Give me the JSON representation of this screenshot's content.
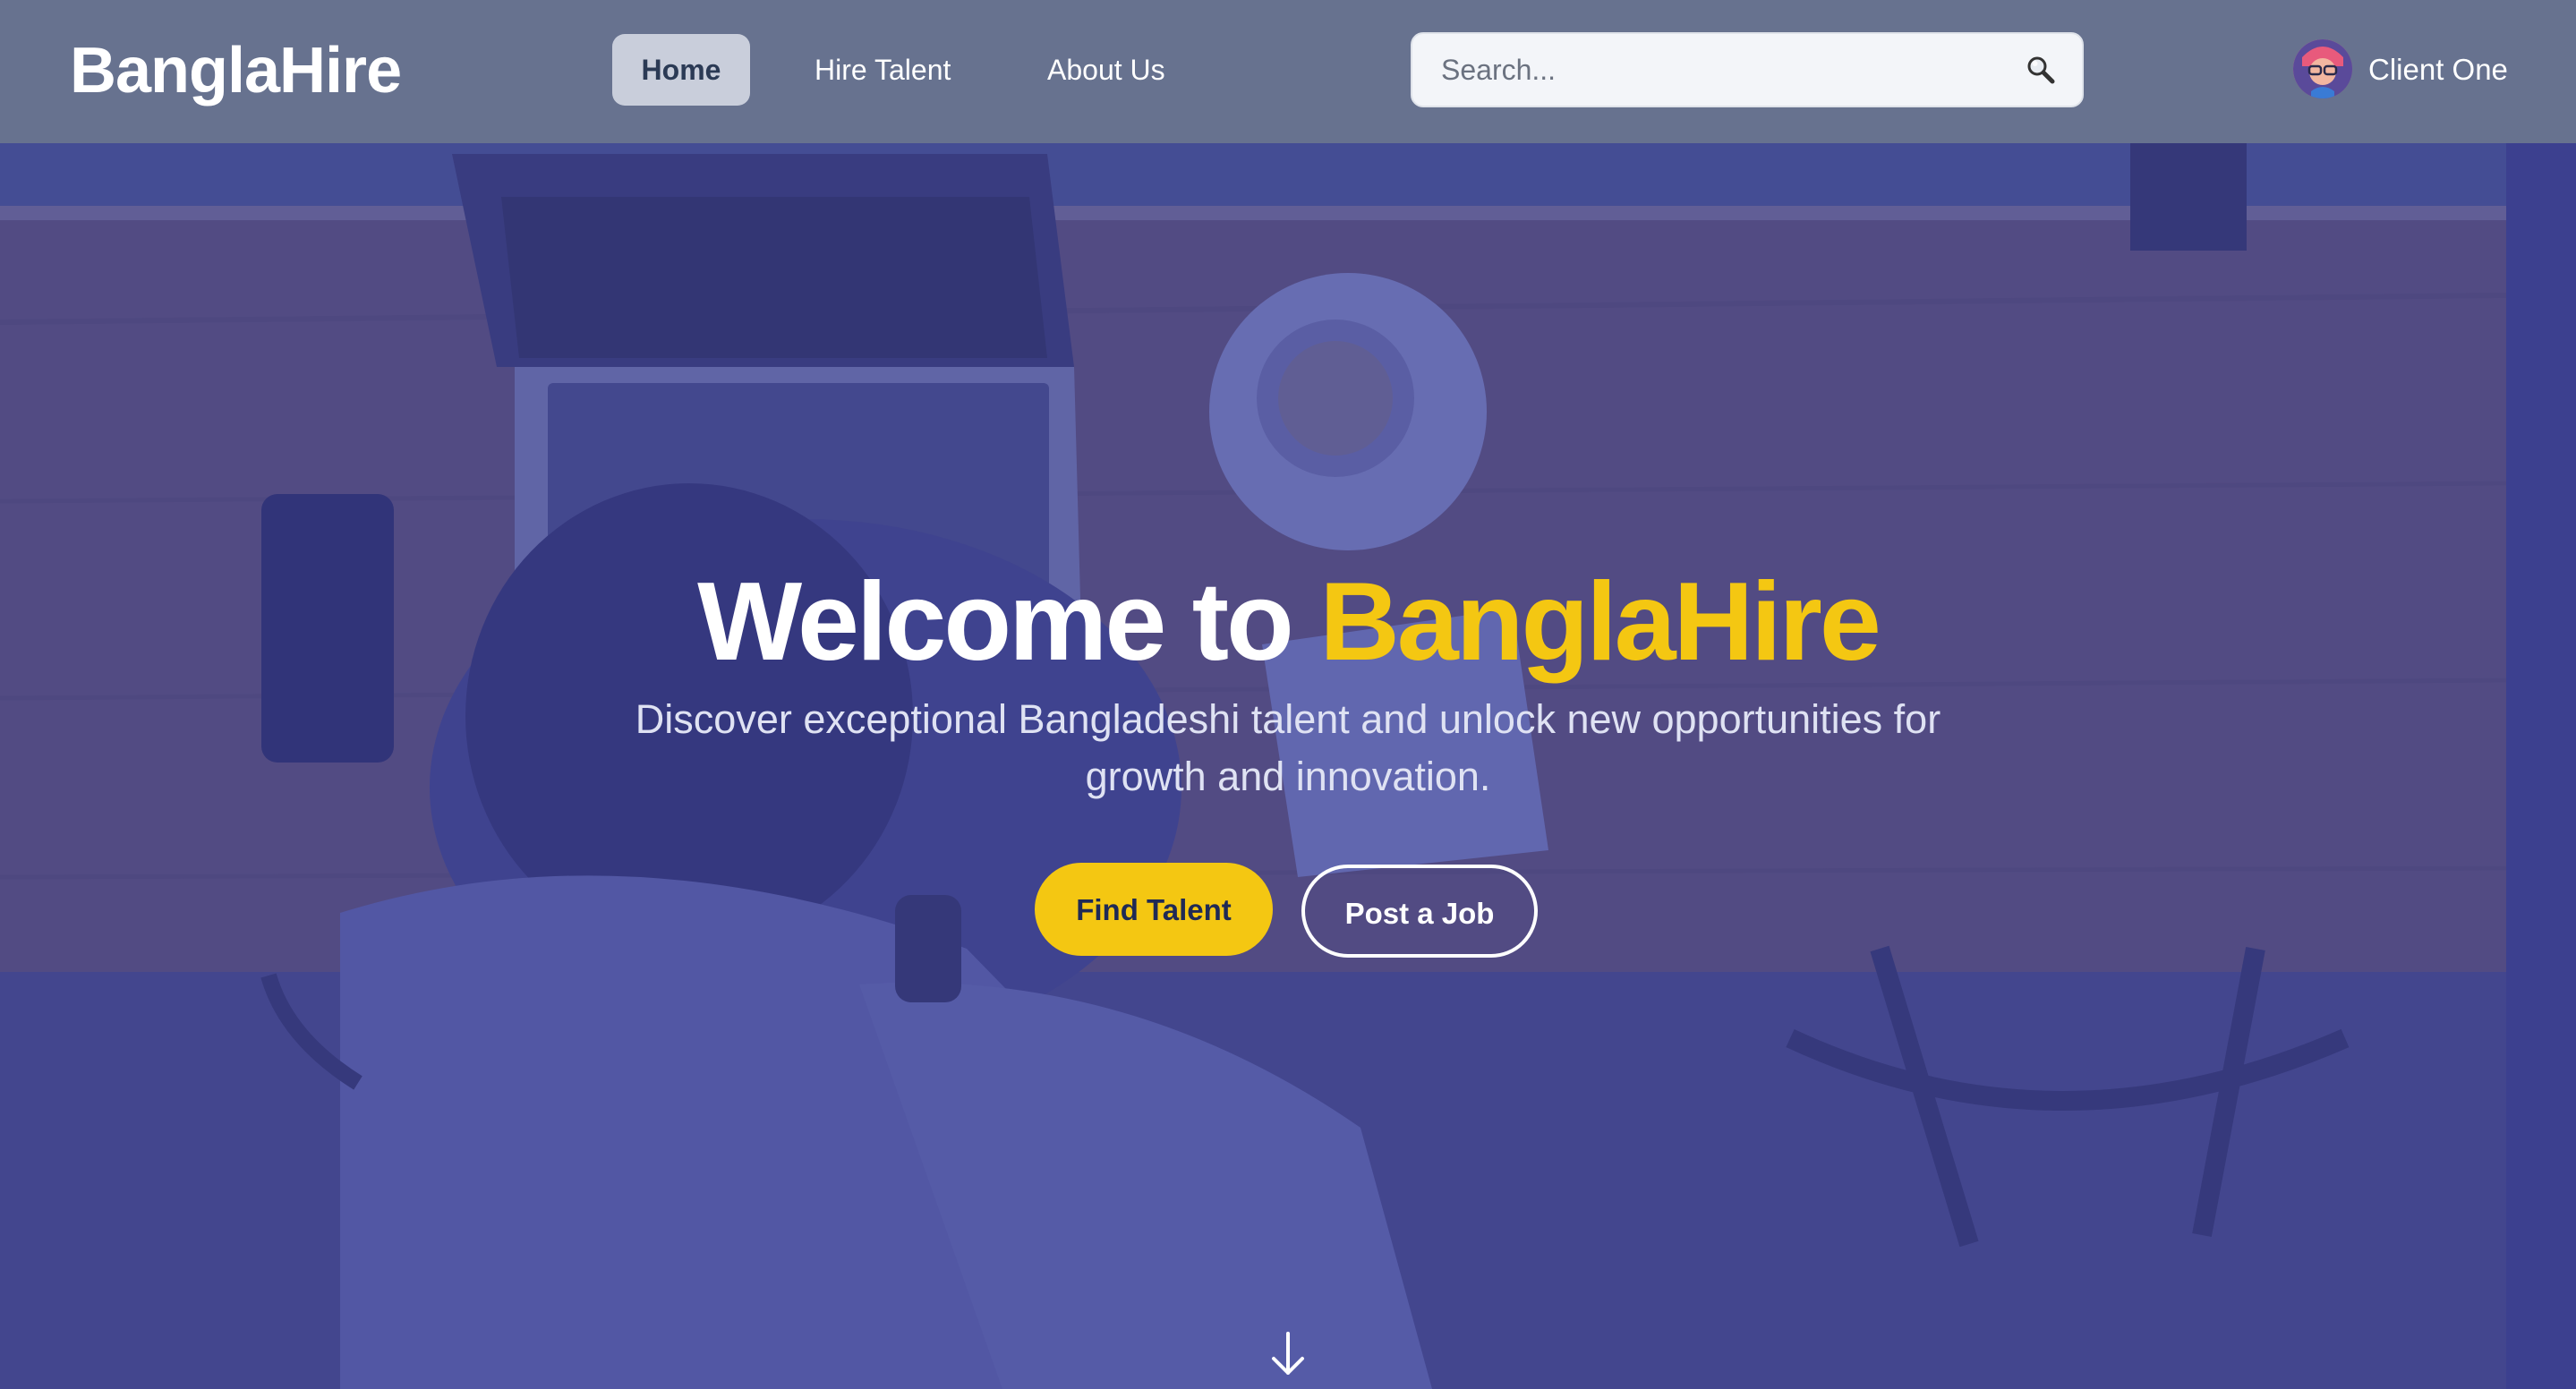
{
  "brand": {
    "name": "BanglaHire"
  },
  "nav": {
    "items": [
      {
        "label": "Home",
        "active": true
      },
      {
        "label": "Hire Talent",
        "active": false
      },
      {
        "label": "About Us",
        "active": false
      }
    ]
  },
  "search": {
    "placeholder": "Search...",
    "value": "",
    "icon": "search-icon"
  },
  "user": {
    "name": "Client One",
    "icon": "avatar"
  },
  "hero": {
    "title_prefix": "Welcome to ",
    "title_accent": "BanglaHire",
    "subtitle": "Discover exceptional Bangladeshi talent and unlock new opportunities for growth and innovation.",
    "primary_button": "Find Talent",
    "secondary_button": "Post a Job",
    "scroll_icon": "arrow-down-icon"
  },
  "colors": {
    "navbar": "#67728f",
    "accent": "#f4c712",
    "hero_overlay": "#3e44a0",
    "active_nav_bg": "#c9cedb"
  }
}
